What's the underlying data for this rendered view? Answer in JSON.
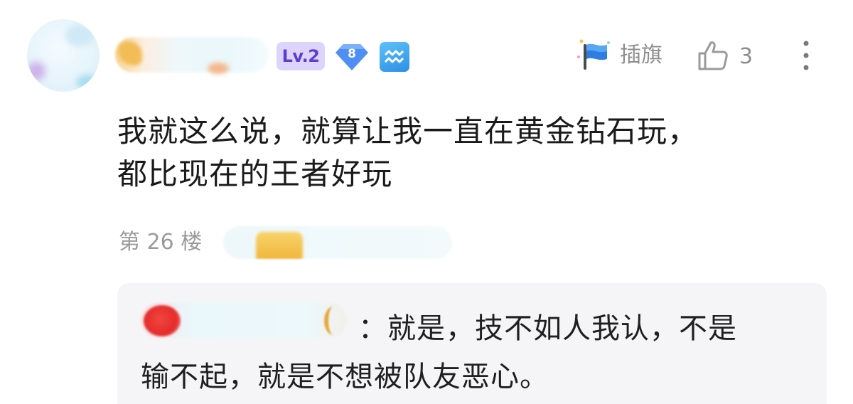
{
  "user": {
    "level": "Lv.2",
    "gem_level": "8"
  },
  "actions": {
    "flag_label": "插旗",
    "like_count": "3"
  },
  "post": {
    "lines": [
      "我就这么说，就算让我一直在黄金钻石玩，",
      "都比现在的王者好玩"
    ],
    "floor": "第 26 楼"
  },
  "reply": {
    "separator": "：",
    "line1": "就是，技不如人我认，不是",
    "line2": "输不起，就是不想被队友恶心。"
  },
  "colors": {
    "level_badge_bg": "#dcd4fb",
    "level_badge_text": "#5b3fd1",
    "gem": "#4f8ff5",
    "aquarius": "#3aa6ef",
    "meta_text": "#8d8d8d",
    "reply_bg": "#f5f5f7"
  },
  "icons": [
    "flag-icon",
    "thumbs-up-icon",
    "more-vertical-icon",
    "gem-icon",
    "aquarius-icon"
  ]
}
